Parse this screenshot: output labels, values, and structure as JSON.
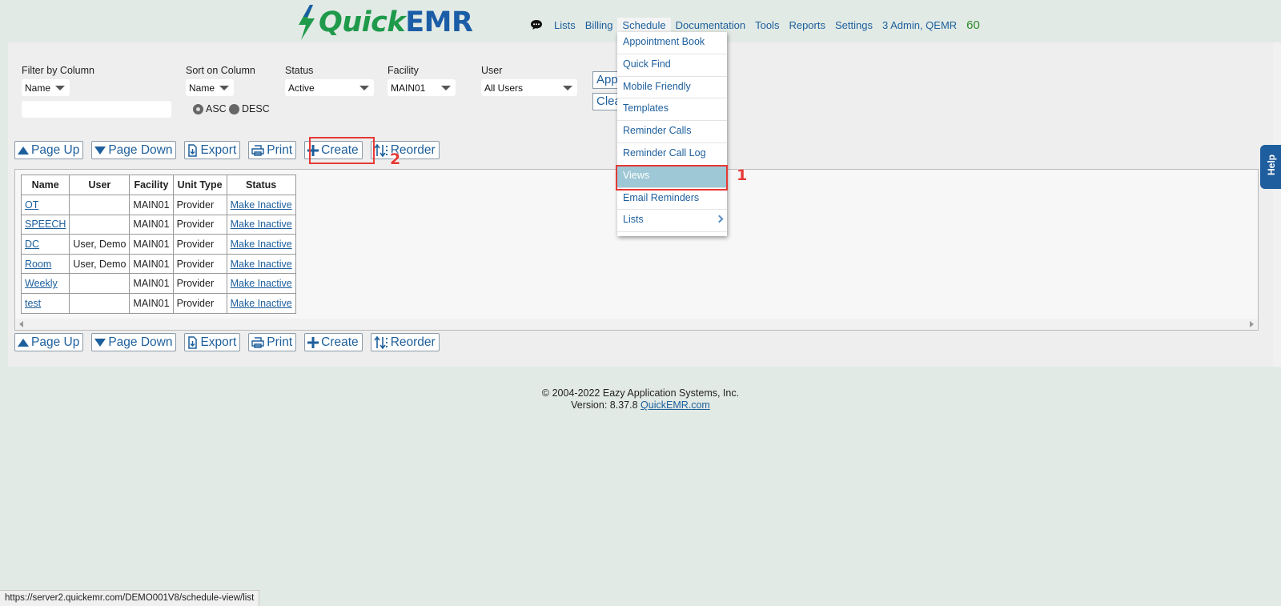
{
  "logo": {
    "part1": "Quick",
    "part2": "EMR"
  },
  "topnav": {
    "items": [
      "Lists",
      "Billing",
      "Schedule",
      "Documentation",
      "Tools",
      "Reports",
      "Settings",
      "3 Admin, QEMR"
    ],
    "count": "60"
  },
  "schedule_menu": {
    "items": [
      "Appointment Book",
      "Quick Find",
      "Mobile Friendly",
      "Templates",
      "Reminder Calls",
      "Reminder Call Log",
      "Views",
      "Email Reminders",
      "Lists"
    ],
    "highlighted": "Views"
  },
  "filters": {
    "filter_by_column": {
      "label": "Filter by Column",
      "value": "Name",
      "text_value": ""
    },
    "sort_on_column": {
      "label": "Sort on Column",
      "value": "Name"
    },
    "sort_order": {
      "asc": "ASC",
      "desc": "DESC",
      "selected": "ASC"
    },
    "status": {
      "label": "Status",
      "value": "Active"
    },
    "facility": {
      "label": "Facility",
      "value": "MAIN01"
    },
    "user": {
      "label": "User",
      "value": "All Users"
    },
    "apply_label": "Apply",
    "clear_label": "Clear"
  },
  "toolbar": {
    "page_up": "Page Up",
    "page_down": "Page Down",
    "export": "Export",
    "print": "Print",
    "create": "Create",
    "reorder": "Reorder"
  },
  "table": {
    "columns": [
      "Name",
      "User",
      "Facility",
      "Unit Type",
      "Status"
    ],
    "rows": [
      {
        "name": "OT",
        "user": "",
        "facility": "MAIN01",
        "unit_type": "Provider",
        "status": "Make Inactive"
      },
      {
        "name": "SPEECH",
        "user": "",
        "facility": "MAIN01",
        "unit_type": "Provider",
        "status": "Make Inactive"
      },
      {
        "name": "DC",
        "user": "User, Demo",
        "facility": "MAIN01",
        "unit_type": "Provider",
        "status": "Make Inactive"
      },
      {
        "name": "Room",
        "user": "User, Demo",
        "facility": "MAIN01",
        "unit_type": "Provider",
        "status": "Make Inactive"
      },
      {
        "name": "Weekly",
        "user": "",
        "facility": "MAIN01",
        "unit_type": "Provider",
        "status": "Make Inactive"
      },
      {
        "name": "test",
        "user": "",
        "facility": "MAIN01",
        "unit_type": "Provider",
        "status": "Make Inactive"
      }
    ]
  },
  "annotations": {
    "step1": "1",
    "step2": "2"
  },
  "help_label": "Help",
  "footer": {
    "copyright": "© 2004-2022 Eazy Application Systems, Inc.",
    "version_prefix": "Version: 8.37.8",
    "link": "QuickEMR.com"
  },
  "status_url": "https://server2.quickemr.com/DEMO001V8/schedule-view/list",
  "colors": {
    "brand_green": "#1f9a4b",
    "brand_blue": "#1b5da6",
    "link": "#1d5f9c",
    "highlight": "#9fc8d6",
    "annotation": "#e53935"
  }
}
